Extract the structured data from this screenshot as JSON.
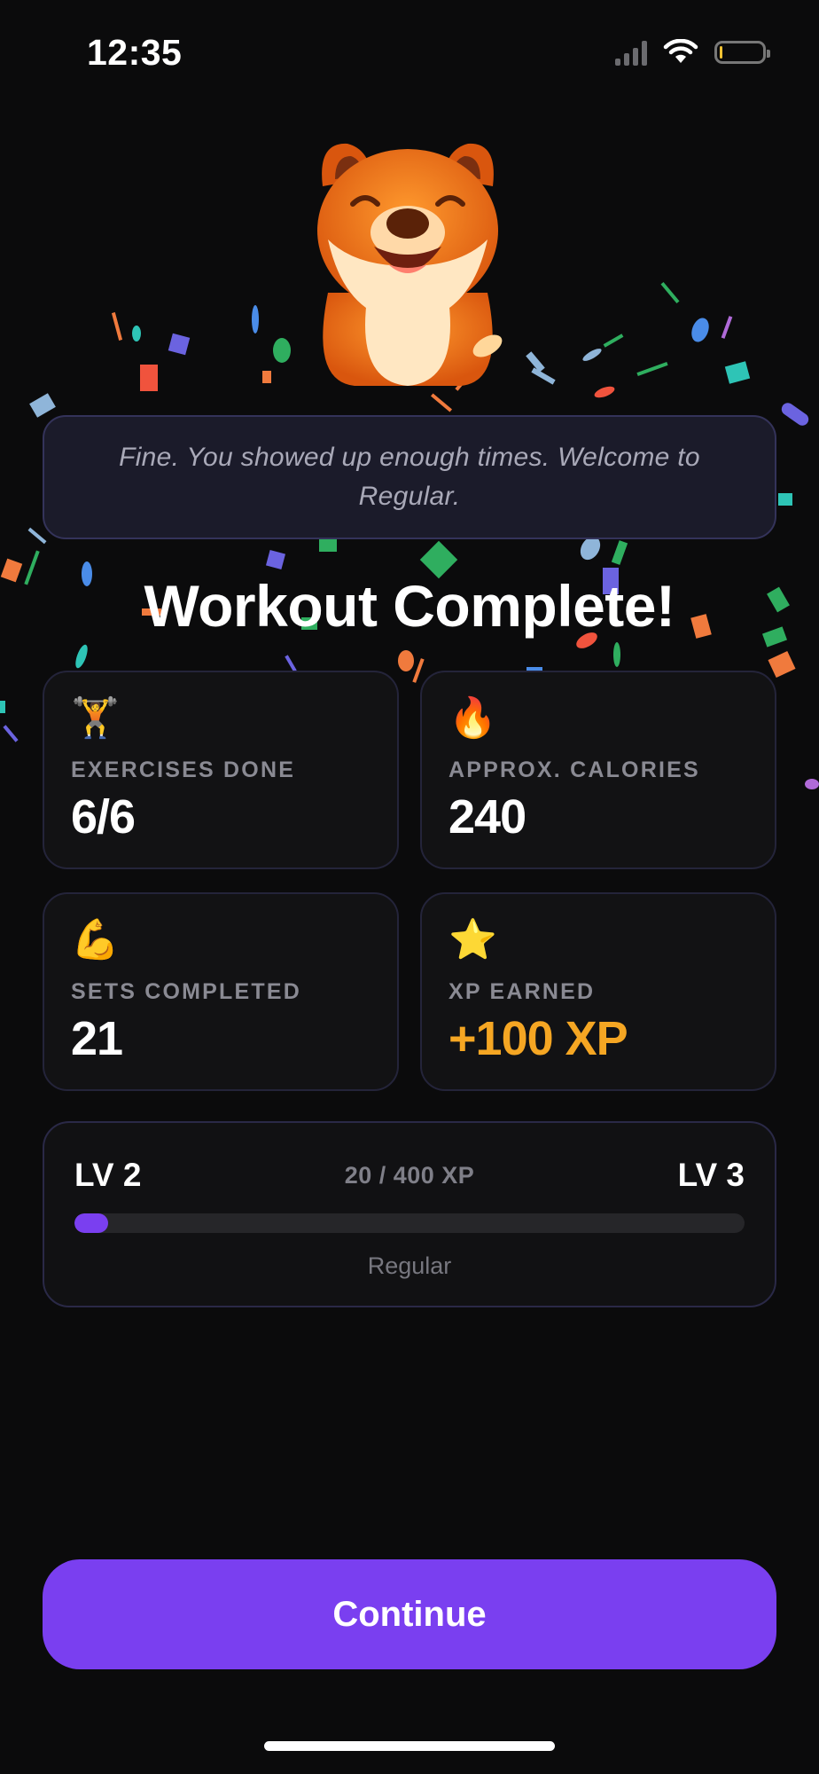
{
  "status_bar": {
    "time": "12:35",
    "icons": [
      "cellular-signal-icon",
      "wifi-icon",
      "battery-low-icon"
    ]
  },
  "mascot": {
    "icon": "happy-dog-mascot"
  },
  "quote": "Fine. You showed up enough times. Welcome to Regular.",
  "title": "Workout Complete!",
  "stats": [
    {
      "icon": "weightlifter-emoji",
      "emoji": "🏋️",
      "label": "EXERCISES DONE",
      "value": "6/6"
    },
    {
      "icon": "fire-emoji",
      "emoji": "🔥",
      "label": "APPROX. CALORIES",
      "value": "240"
    },
    {
      "icon": "flexed-biceps-emoji",
      "emoji": "💪",
      "label": "SETS COMPLETED",
      "value": "21"
    },
    {
      "icon": "star-emoji",
      "emoji": "⭐",
      "label": "XP EARNED",
      "value": "+100 XP"
    }
  ],
  "level": {
    "current": "LV 2",
    "next": "LV 3",
    "xp_text": "20 / 400 XP",
    "progress": 0.05,
    "rank": "Regular"
  },
  "continue_label": "Continue",
  "colors": {
    "background": "#0b0b0c",
    "accent": "#7a3ff0",
    "xp_gold": "#f5a623",
    "card": "#121214",
    "quote_card": "#1b1b2a"
  }
}
